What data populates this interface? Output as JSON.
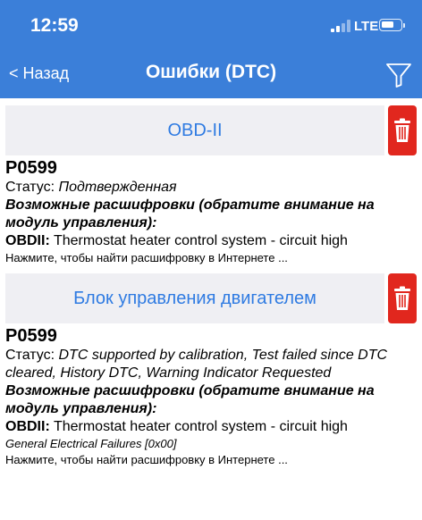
{
  "status_bar": {
    "time": "12:59",
    "network": "LTE",
    "battery_level": 0.7
  },
  "nav": {
    "back_label": "< Назад",
    "title": "Ошибки (DTC)"
  },
  "colors": {
    "header": "#3b7fd9",
    "section_title": "#2f7be2",
    "section_bg": "#efeff3",
    "delete": "#e1271e"
  },
  "sections": [
    {
      "title": "OBD-II",
      "code": "P0599",
      "status_label": "Статус:",
      "status_value": "Подтвержденная",
      "possible_label": "Возможные расшифровки (обратите внимание на модуль управления):",
      "decode_prefix": "OBDII:",
      "decode_text": "Thermostat heater control system - circuit high",
      "extra": "",
      "search_link": "Нажмите, чтобы найти расшифровку в Интернете ..."
    },
    {
      "title": "Блок управления двигателем",
      "code": "P0599",
      "status_label": "Статус:",
      "status_value": "DTC supported by calibration, Test failed since DTC cleared, History DTC, Warning Indicator Requested",
      "possible_label": "Возможные расшифровки (обратите внимание на модуль управления):",
      "decode_prefix": "OBDII:",
      "decode_text": "Thermostat heater control system - circuit high",
      "extra": "General Electrical Failures [0x00]",
      "search_link": "Нажмите, чтобы найти расшифровку в Интернете ..."
    }
  ]
}
